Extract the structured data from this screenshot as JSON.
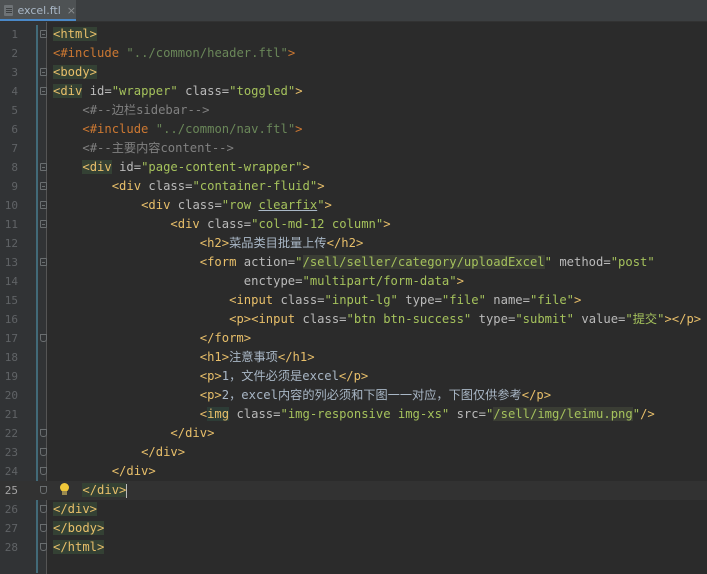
{
  "tab": {
    "label": "excel.ftl",
    "close": "×"
  },
  "lines": [
    {
      "n": "1",
      "html": "<span class=\"t-tag t-hl\">&lt;html&gt;</span>"
    },
    {
      "n": "2",
      "html": "<span class=\"t-ftl\">&lt;#include</span> <span class=\"t-str\">\"../common/header.ftl\"</span><span class=\"t-ftl\">&gt;</span>"
    },
    {
      "n": "3",
      "html": "<span class=\"t-tag t-hl\">&lt;body&gt;</span>"
    },
    {
      "n": "4",
      "html": "<span class=\"t-tag t-hl\">&lt;div</span> <span class=\"t-attr\">id=</span><span class=\"t-val\">\"wrapper\"</span> <span class=\"t-attr\">class=</span><span class=\"t-val\">\"toggled\"</span><span class=\"t-tag\">&gt;</span>"
    },
    {
      "n": "5",
      "html": "    <span class=\"t-com\">&lt;#--边栏sidebar--&gt;</span>"
    },
    {
      "n": "6",
      "html": "    <span class=\"t-ftl\">&lt;#include</span> <span class=\"t-str\">\"../common/nav.ftl\"</span><span class=\"t-ftl\">&gt;</span>"
    },
    {
      "n": "7",
      "html": "    <span class=\"t-com\">&lt;#--主要内容content--&gt;</span>"
    },
    {
      "n": "8",
      "html": "    <span class=\"t-tag t-hl\">&lt;div</span> <span class=\"t-attr\">id=</span><span class=\"t-val\">\"page-content-wrapper\"</span><span class=\"t-tag\">&gt;</span>"
    },
    {
      "n": "9",
      "html": "        <span class=\"t-tag\">&lt;div</span> <span class=\"t-attr\">class=</span><span class=\"t-val\">\"container-fluid\"</span><span class=\"t-tag\">&gt;</span>"
    },
    {
      "n": "10",
      "html": "            <span class=\"t-tag\">&lt;div</span> <span class=\"t-attr\">class=</span><span class=\"t-val\">\"row <span class=\"t-under\">clearfix</span>\"</span><span class=\"t-tag\">&gt;</span>"
    },
    {
      "n": "11",
      "html": "                <span class=\"t-tag\">&lt;div</span> <span class=\"t-attr\">class=</span><span class=\"t-val\">\"col-md-12 column\"</span><span class=\"t-tag\">&gt;</span>"
    },
    {
      "n": "12",
      "html": "                    <span class=\"t-tag\">&lt;h2&gt;</span><span class=\"t-txt\">菜品类目批量上传</span><span class=\"t-tag\">&lt;/h2&gt;</span>"
    },
    {
      "n": "13",
      "html": "                    <span class=\"t-tag\">&lt;form</span> <span class=\"t-attr\">action=</span><span class=\"t-val\">\"<span class=\"t-link\">/sell/seller/category/uploadExcel</span>\"</span> <span class=\"t-attr\">method=</span><span class=\"t-val\">\"post\"</span>"
    },
    {
      "n": "14",
      "html": "                          <span class=\"t-attr\">enctype=</span><span class=\"t-val\">\"multipart/form-data\"</span><span class=\"t-tag\">&gt;</span>"
    },
    {
      "n": "15",
      "html": "                        <span class=\"t-tag\">&lt;input</span> <span class=\"t-attr\">class=</span><span class=\"t-val\">\"input-lg\"</span> <span class=\"t-attr\">type=</span><span class=\"t-val\">\"file\"</span> <span class=\"t-attr\">name=</span><span class=\"t-val\">\"file\"</span><span class=\"t-tag\">&gt;</span>"
    },
    {
      "n": "16",
      "html": "                        <span class=\"t-tag\">&lt;p&gt;&lt;input</span> <span class=\"t-attr\">class=</span><span class=\"t-val\">\"btn btn-success\"</span> <span class=\"t-attr\">type=</span><span class=\"t-val\">\"submit\"</span> <span class=\"t-attr\">value=</span><span class=\"t-val\">\"提交\"</span><span class=\"t-tag\">&gt;&lt;/p&gt;</span>"
    },
    {
      "n": "17",
      "html": "                    <span class=\"t-tag\">&lt;/form&gt;</span>"
    },
    {
      "n": "18",
      "html": "                    <span class=\"t-tag\">&lt;h1&gt;</span><span class=\"t-txt\">注意事项</span><span class=\"t-tag\">&lt;/h1&gt;</span>"
    },
    {
      "n": "19",
      "html": "                    <span class=\"t-tag\">&lt;p&gt;</span><span class=\"t-txt\">1，文件必须是excel</span><span class=\"t-tag\">&lt;/p&gt;</span>"
    },
    {
      "n": "20",
      "html": "                    <span class=\"t-tag\">&lt;p&gt;</span><span class=\"t-txt\">2，excel内容的列必须和下图一一对应，下图仅供参考</span><span class=\"t-tag\">&lt;/p&gt;</span>"
    },
    {
      "n": "21",
      "html": "                    <span class=\"t-tag\">&lt;<span class=\"t-ref\">img</span></span> <span class=\"t-attr\">class=</span><span class=\"t-val\">\"img-responsive img-xs\"</span> <span class=\"t-attr\">src=</span><span class=\"t-val\">\"<span class=\"t-link\">/sell/img/leimu.png</span>\"</span><span class=\"t-tag\">/&gt;</span>"
    },
    {
      "n": "22",
      "html": "                <span class=\"t-tag\">&lt;/div&gt;</span>"
    },
    {
      "n": "23",
      "html": "            <span class=\"t-tag\">&lt;/div&gt;</span>"
    },
    {
      "n": "24",
      "html": "        <span class=\"t-tag\">&lt;/div&gt;</span>"
    },
    {
      "n": "25",
      "html": "    <span class=\"t-tag t-hl\">&lt;/div&gt;</span><span class=\"cursor-caret\"></span>"
    },
    {
      "n": "26",
      "html": "<span class=\"t-tag t-hl\">&lt;/div&gt;</span>"
    },
    {
      "n": "27",
      "html": "<span class=\"t-tag t-hl\">&lt;/body&gt;</span>"
    },
    {
      "n": "28",
      "html": "<span class=\"t-tag t-hl\">&lt;/html&gt;</span>"
    }
  ],
  "current_line": "25",
  "icons": {
    "tab_file": "file-icon",
    "intention": "lightbulb-icon"
  },
  "colors": {
    "background": "#2b2b2b",
    "gutter": "#313335",
    "tag": "#e8bf6a",
    "value": "#a5c25c",
    "comment": "#808080",
    "directive": "#cc7832"
  }
}
